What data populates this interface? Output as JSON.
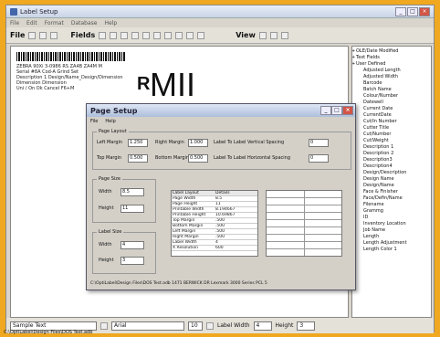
{
  "window": {
    "title": "Label Setup",
    "menu": [
      "File",
      "Edit",
      "Format",
      "Database",
      "Help"
    ],
    "toolbar": {
      "file_label": "File",
      "fields_label": "Fields",
      "view_label": "View"
    }
  },
  "canvas": {
    "lines": [
      "ZEBRA 90Xi 3-0986 RS ZA4B ZA4M M",
      "Serial #8A    Cod-A    Grind Set",
      "Description 1     Design/Name_Design/Dimension",
      "Dimension       Dimension",
      "Uni / On  Ok  Cancel       F6+M"
    ],
    "big_r": "R",
    "big_text": "MII"
  },
  "tree": {
    "roots": [
      "OLE/Date Modified",
      "Text Fields",
      "User Defined"
    ],
    "items": [
      "Adjusted Length",
      "Adjusted Width",
      "Barcode",
      "Batch Name",
      "Colour/Number",
      "Datewell",
      "Current Date",
      "CurrentDate",
      "Cut/In Number",
      "Cutter Title",
      "Cut/Number",
      "Cut/Weight",
      "Description 1",
      "Description 2",
      "Description3",
      "Description4",
      "Design/Description",
      "Design Name",
      "Design/Name",
      "Face & Finisher",
      "Face/Defin/Name",
      "Filename",
      "Grammg",
      "ID",
      "Inventory Location",
      "Job Name",
      "Length",
      "Length Adjustment",
      "Length Color 1"
    ]
  },
  "status": {
    "font_sample": "Sample Text",
    "font_name": "Arial",
    "font_size": "10",
    "label_width_label": "Label Width",
    "label_width": "4",
    "height_label": "Height",
    "height": "3",
    "path": "C:\\OptiLabel\\Design Files\\DOS Test.adb"
  },
  "dialog": {
    "title": "Page Setup",
    "menu": [
      "File",
      "Help"
    ],
    "page_layout_title": "Page Layout",
    "left_margin_label": "Left Margin",
    "left_margin": "1.250",
    "right_margin_label": "Right Margin",
    "right_margin": "1.000",
    "top_margin_label": "Top Margin",
    "top_margin": "0.500",
    "bottom_margin_label": "Bottom Margin",
    "bottom_margin": "0.500",
    "vertical_spacing_label": "Label To Label Vertical Spacing",
    "vertical_spacing": "0",
    "horizontal_spacing_label": "Label To Label Horizontal Spacing",
    "horizontal_spacing": "0",
    "page_size_title": "Page Size",
    "width_label": "Width",
    "width": "8.5",
    "height_label": "Height",
    "height": "11",
    "label_size_title": "Label Size",
    "label_width_label": "Width",
    "label_width": "4",
    "label_height_label": "Height",
    "label_height": "3",
    "table_header": [
      "Label Layout",
      "Details"
    ],
    "table_rows": [
      [
        "Page Width",
        "8.5"
      ],
      [
        "Page Height",
        "11"
      ],
      [
        "Printable Width",
        "8.194667"
      ],
      [
        "Printable Height",
        "10.69867"
      ],
      [
        "Top Margin",
        ".500"
      ],
      [
        "Bottom Margin",
        ".500"
      ],
      [
        "Left Margin",
        ".500"
      ],
      [
        "Right Margin",
        ".500"
      ],
      [
        "Label Width",
        "4"
      ],
      [
        "X Resolution",
        "600"
      ]
    ],
    "status": "C:\\OptiLabel\\Design Files\\DOS Test.adb     1471 BERWICK DR Lexmark 3000 Series PCL 5"
  }
}
